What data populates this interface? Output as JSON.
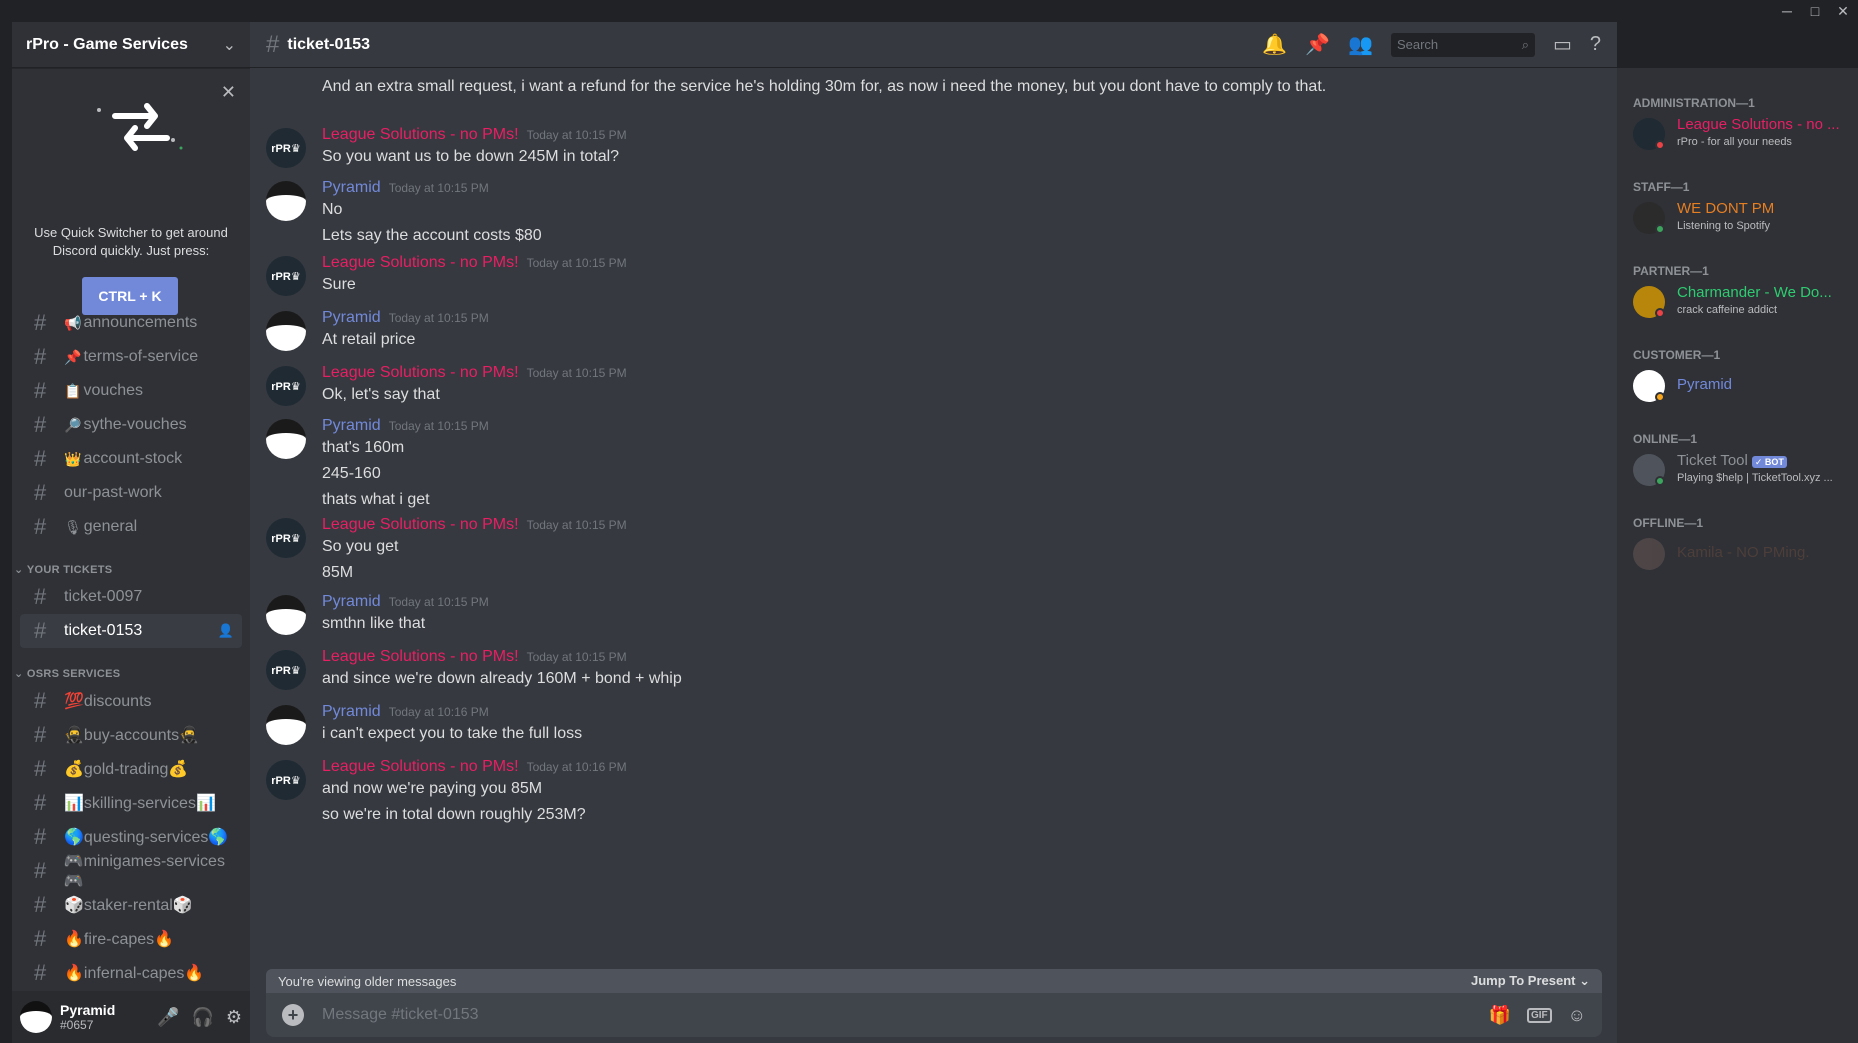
{
  "window": {
    "minimize": "─",
    "maximize": "□",
    "close": "✕"
  },
  "server": {
    "name": "rPro - Game Services",
    "chevron": "⌄"
  },
  "quick_switcher": {
    "text": "Use Quick Switcher to get around Discord quickly. Just press:",
    "button": "CTRL + K",
    "close": "✕"
  },
  "channels": [
    {
      "emoji": "📢",
      "name": "announcements"
    },
    {
      "emoji": "📌",
      "name": "terms-of-service"
    },
    {
      "emoji": "📋",
      "name": "vouches"
    },
    {
      "emoji": "🔎",
      "name": "sythe-vouches"
    },
    {
      "emoji": "👑",
      "name": "account-stock"
    },
    {
      "emoji": "",
      "name": "our-past-work"
    },
    {
      "emoji": "🎙",
      "name": "general"
    }
  ],
  "categories": {
    "tickets": "YOUR TICKETS",
    "osrs": "OSRS SERVICES"
  },
  "tickets": [
    {
      "name": "ticket-0097"
    },
    {
      "name": "ticket-0153"
    }
  ],
  "osrs_channels": [
    {
      "name": "💯discounts"
    },
    {
      "name": "🥷buy-accounts🥷"
    },
    {
      "name": "💰gold-trading💰"
    },
    {
      "name": "📊skilling-services📊"
    },
    {
      "name": "🌎questing-services🌎"
    },
    {
      "name": "🎮minigames-services🎮"
    },
    {
      "name": "🎲staker-rental🎲"
    },
    {
      "name": "🔥fire-capes🔥"
    },
    {
      "name": "🔥infernal-capes🔥"
    }
  ],
  "user": {
    "name": "Pyramid",
    "tag": "#0657"
  },
  "channel_header": {
    "title": "ticket-0153",
    "search_placeholder": "Search"
  },
  "messages": {
    "top_line": "And an extra small request, i want a refund for the service he's holding 30m for, as now i need the money, but you dont have to comply to that.",
    "ls_name": "League Solutions - no PMs!",
    "py_name": "Pyramid",
    "ls_avatar": "rPR♛",
    "groups": [
      {
        "who": "ls",
        "time": "Today at 10:15 PM",
        "lines": [
          "So you want us to be down 245M in total?"
        ]
      },
      {
        "who": "py",
        "time": "Today at 10:15 PM",
        "lines": [
          "No",
          "Lets say the account costs $80"
        ]
      },
      {
        "who": "ls",
        "time": "Today at 10:15 PM",
        "lines": [
          "Sure"
        ]
      },
      {
        "who": "py",
        "time": "Today at 10:15 PM",
        "lines": [
          "At retail price"
        ]
      },
      {
        "who": "ls",
        "time": "Today at 10:15 PM",
        "lines": [
          "Ok, let's say that"
        ]
      },
      {
        "who": "py",
        "time": "Today at 10:15 PM",
        "lines": [
          "that's 160m",
          "245-160",
          "thats what i get"
        ]
      },
      {
        "who": "ls",
        "time": "Today at 10:15 PM",
        "lines": [
          "So you get",
          "85M"
        ]
      },
      {
        "who": "py",
        "time": "Today at 10:15 PM",
        "lines": [
          "smthn like that"
        ]
      },
      {
        "who": "ls",
        "time": "Today at 10:15 PM",
        "lines": [
          "and since we're down already 160M + bond + whip"
        ]
      },
      {
        "who": "py",
        "time": "Today at 10:16 PM",
        "lines": [
          "i can't expect you to take the full loss"
        ]
      },
      {
        "who": "ls",
        "time": "Today at 10:16 PM",
        "lines": [
          "and now we're paying you 85M",
          "so we're in total down roughly 253M?"
        ]
      }
    ]
  },
  "older_bar": {
    "text": "You're viewing older messages",
    "jump": "Jump To Present ⌄"
  },
  "composer": {
    "placeholder": "Message #ticket-0153"
  },
  "members": {
    "categories": [
      "ADMINISTRATION—1",
      "STAFF—1",
      "PARTNER—1",
      "CUSTOMER—1",
      "ONLINE—1",
      "OFFLINE—1"
    ],
    "list": [
      {
        "name": "League Solutions - no ...",
        "status": "rPro - for all your needs",
        "color": "#e91e63"
      },
      {
        "name": "WE DONT PM",
        "status": "Listening to Spotify",
        "color": "#e67e22"
      },
      {
        "name": "Charmander - We Do...",
        "status": "crack caffeine addict",
        "color": "#2ecc71"
      },
      {
        "name": "Pyramid",
        "status": "",
        "color": "#7289da"
      },
      {
        "name": "Ticket Tool",
        "status": "Playing $help | TicketTool.xyz ...",
        "color": "#8e9297",
        "badge": "✓ BOT"
      },
      {
        "name": "Kamila - NO PMing.",
        "status": "",
        "color": "#6b4b3e"
      }
    ]
  }
}
